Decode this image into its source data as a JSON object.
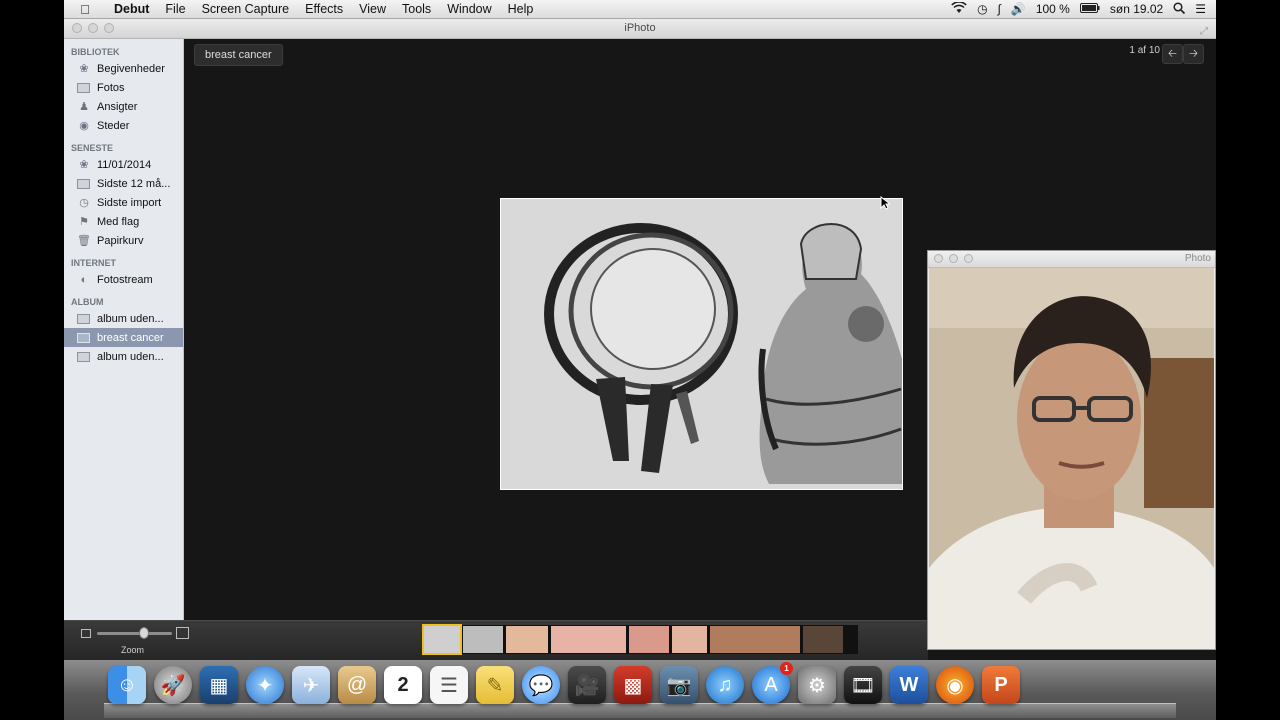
{
  "menubar": {
    "app_name": "Debut",
    "items": [
      "File",
      "Screen Capture",
      "Effects",
      "View",
      "Tools",
      "Window",
      "Help"
    ],
    "battery": "100 %",
    "clock": "søn 19.02"
  },
  "window": {
    "title": "iPhoto"
  },
  "sidebar": {
    "sections": [
      {
        "heading": "BIBLIOTEK",
        "items": [
          "Begivenheder",
          "Fotos",
          "Ansigter",
          "Steder"
        ]
      },
      {
        "heading": "SENESTE",
        "items": [
          "11/01/2014",
          "Sidste 12 må...",
          "Sidste import",
          "Med flag",
          "Papirkurv"
        ]
      },
      {
        "heading": "INTERNET",
        "items": [
          "Fotostream"
        ]
      },
      {
        "heading": "ALBUM",
        "items": [
          "album uden...",
          "breast cancer",
          "album uden..."
        ]
      }
    ],
    "selected": "breast cancer"
  },
  "viewer": {
    "breadcrumb": "breast cancer",
    "counter": "1 af 10"
  },
  "toolbar": {
    "zoom_label": "Zoom",
    "zoom_level": 0.6
  },
  "cam": {
    "title": "Photo"
  },
  "dock": {
    "calendar_day": "2",
    "appstore_badge": "1"
  },
  "colors": {
    "sidebar_bg": "#e6e9ee",
    "selection": "#8a97ae",
    "content_bg": "#161616"
  }
}
